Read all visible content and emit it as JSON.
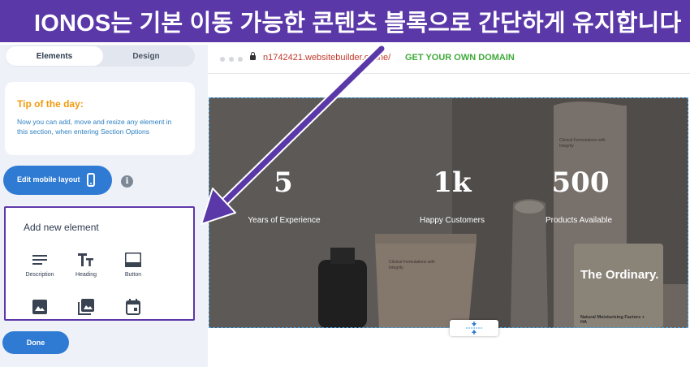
{
  "banner": {
    "title": "IONOS는 기본 이동 가능한 콘텐츠 블록으로 간단하게 유지합니다"
  },
  "sidebar": {
    "tabs": [
      "Elements",
      "Design"
    ],
    "tip": {
      "title": "Tip of the day:",
      "text": "Now you can add, move and resize any element in this section, when entering Section Options"
    },
    "mobile_button": {
      "label": "Edit mobile layout",
      "icon": "phone-icon"
    },
    "info_icon": {
      "glyph": "i"
    },
    "add_element": {
      "title": "Add new element",
      "items": [
        {
          "label": "Description",
          "icon": "description-icon"
        },
        {
          "label": "Heading",
          "icon": "heading-icon"
        },
        {
          "label": "Button",
          "icon": "button-icon"
        },
        {
          "label": "",
          "icon": "image-icon"
        },
        {
          "label": "",
          "icon": "gallery-icon"
        },
        {
          "label": "",
          "icon": "calendar-icon"
        }
      ]
    },
    "done_button": {
      "label": "Done"
    }
  },
  "browser": {
    "url": "n1742421.websitebuilder.online/",
    "domain_link": "GET YOUR OWN DOMAIN"
  },
  "hero": {
    "stats": [
      {
        "value": "5",
        "label": "Years of Experience"
      },
      {
        "value": "1k",
        "label": "Happy Customers"
      },
      {
        "value": "500",
        "label": "Products Available"
      }
    ],
    "products": {
      "tube_text": "Clinical Formulations with Integrity",
      "brand": "The Ordinary.",
      "bottle_text": "Natural Moisturizing Factors + HA"
    }
  },
  "colors": {
    "accent_purple": "#5b38a8",
    "button_blue": "#2f7bd4",
    "tip_orange": "#f19a0e",
    "link_green": "#3faa3a",
    "url_red": "#c0392b"
  }
}
